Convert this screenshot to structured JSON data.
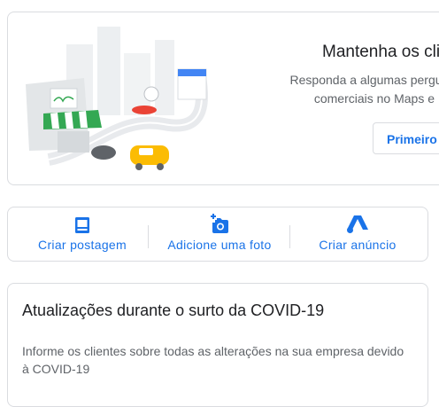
{
  "promo": {
    "title": "Mantenha os clie",
    "description_lines": [
      "Responda a algumas pergunta",
      "comerciais no Maps e"
    ],
    "button_label": "Primeiro"
  },
  "actions": [
    {
      "label": "Criar postagem",
      "icon": "post-icon"
    },
    {
      "label": "Adicione uma foto",
      "icon": "add-photo-icon"
    },
    {
      "label": "Criar anúncio",
      "icon": "google-ads-icon"
    }
  ],
  "covid": {
    "title": "Atualizações durante o surto da COVID-19",
    "text": "Informe os clientes sobre todas as alterações na sua empresa devido à COVID-19"
  },
  "colors": {
    "accent": "#1a73e8",
    "border": "#dadce0",
    "secondary_text": "#5f6368"
  }
}
